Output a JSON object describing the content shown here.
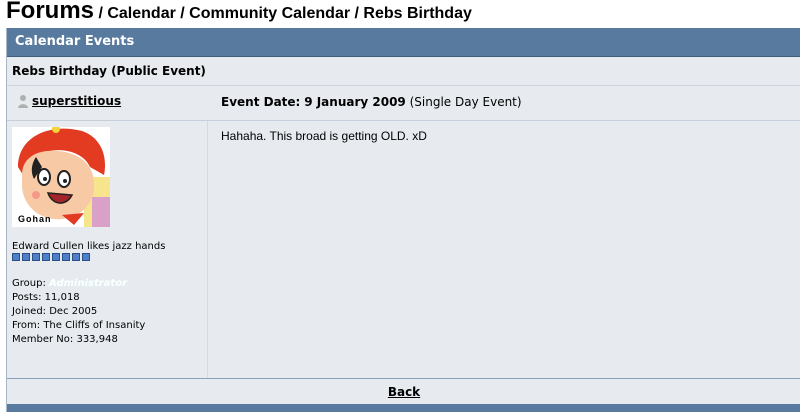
{
  "breadcrumb": {
    "forums": "Forums",
    "trail": " / Calendar / Community Calendar / Rebs Birthday"
  },
  "header": {
    "title": "Calendar Events"
  },
  "event": {
    "title": "Rebs Birthday (Public Event)",
    "date_label": "Event Date:",
    "date_value": "9 January 2009",
    "date_note": "(Single Day Event)"
  },
  "poster": {
    "name": "superstitious",
    "avatar_caption": "Gohan",
    "member_title": "Edward Cullen likes jazz hands",
    "pips": 8,
    "group_label": "Group:",
    "group_value": "Administrator",
    "posts": "Posts: 11,018",
    "joined": "Joined: Dec 2005",
    "from": "From: The Cliffs of Insanity",
    "member_no": "Member No: 333,948"
  },
  "post": {
    "text": "Hahaha. This broad is getting OLD. xD"
  },
  "footer": {
    "back_label": "Back"
  },
  "colors": {
    "header_bar": "#577a9e",
    "panel": "#e7ebf0",
    "pip": "#4f7fc8"
  }
}
